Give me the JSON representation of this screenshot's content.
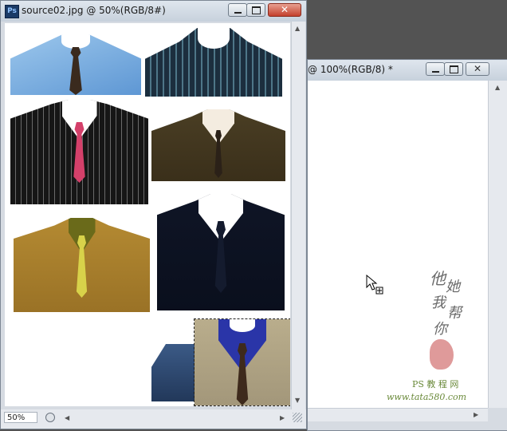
{
  "window_back": {
    "title": "@ 100%(RGB/8) *"
  },
  "window_front": {
    "title": "source02.jpg @ 50%(RGB/8#)",
    "app_icon": "Ps",
    "zoom": "50%"
  },
  "watermark": {
    "chars": [
      "他",
      "她",
      "我",
      "帮",
      "你"
    ],
    "line1": "PS 教 程 网",
    "line2": "www.tata580.com"
  },
  "colors": {
    "selection_border": "#222222",
    "canvas": "#ffffff"
  },
  "icons": [
    "photoshop-app-icon",
    "minimize-icon",
    "maximize-icon",
    "close-icon",
    "move-cursor-icon",
    "status-menu-icon"
  ]
}
